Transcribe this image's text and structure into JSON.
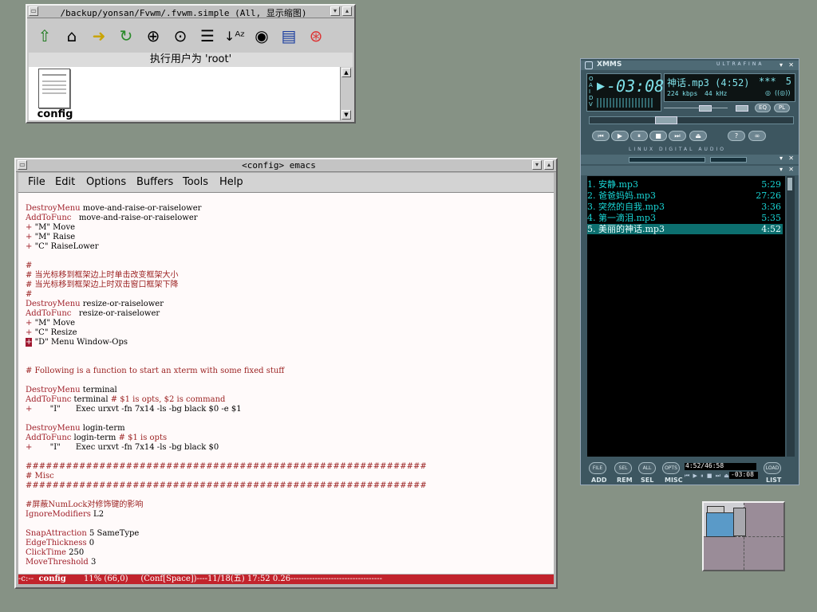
{
  "file_manager": {
    "title": "/backup/yonsan/Fvwm/.fvwm.simple (All, 显示缩图)",
    "status": "执行用户为 'root'",
    "files": [
      {
        "name": "config"
      }
    ],
    "toolbar": [
      "up-icon",
      "home-icon",
      "goto-icon",
      "refresh-icon",
      "zoom-in-icon",
      "zoom-fit-icon",
      "list-view-icon",
      "sort-icon",
      "eye-icon",
      "details-icon",
      "help-icon"
    ]
  },
  "emacs": {
    "title": "<config> emacs",
    "menu": [
      "File",
      "Edit",
      "Options",
      "Buffers",
      "Tools",
      "Help"
    ],
    "lines": [
      [],
      [
        [
          "kw",
          "DestroyMenu"
        ],
        [
          "pl",
          " move-and-raise-or-raiselower"
        ]
      ],
      [
        [
          "kw",
          "AddToFunc"
        ],
        [
          "pl",
          "   move-and-raise-or-raiselower"
        ]
      ],
      [
        [
          "kw",
          "+"
        ],
        [
          "pl",
          " \"M\" Move"
        ]
      ],
      [
        [
          "kw",
          "+"
        ],
        [
          "pl",
          " \"M\" Raise"
        ]
      ],
      [
        [
          "kw",
          "+"
        ],
        [
          "pl",
          " \"C\" RaiseLower"
        ]
      ],
      [],
      [
        [
          "cm",
          "#"
        ]
      ],
      [
        [
          "cm",
          "# 当光标移到框架边上时单击改变框架大小"
        ]
      ],
      [
        [
          "cm",
          "# 当光标移到框架边上时双击窗口框架下降"
        ]
      ],
      [
        [
          "cm",
          "#"
        ]
      ],
      [
        [
          "kw",
          "DestroyMenu"
        ],
        [
          "pl",
          " resize-or-raiselower"
        ]
      ],
      [
        [
          "kw",
          "AddToFunc"
        ],
        [
          "pl",
          "   resize-or-raiselower"
        ]
      ],
      [
        [
          "kw",
          "+"
        ],
        [
          "pl",
          " \"M\" Move"
        ]
      ],
      [
        [
          "kw",
          "+"
        ],
        [
          "pl",
          " \"C\" Resize"
        ]
      ],
      [
        [
          "cursor",
          "+"
        ],
        [
          "pl",
          " \"D\" Menu Window-Ops"
        ]
      ],
      [],
      [],
      [
        [
          "cm",
          "# Following is a function to start an xterm with some fixed stuff"
        ]
      ],
      [],
      [
        [
          "kw",
          "DestroyMenu"
        ],
        [
          "pl",
          " terminal"
        ]
      ],
      [
        [
          "kw",
          "AddToFunc"
        ],
        [
          "pl",
          " terminal "
        ],
        [
          "cm",
          "# $1 is opts, $2 is command"
        ]
      ],
      [
        [
          "kw",
          "+"
        ],
        [
          "pl",
          "       \"I\"      Exec urxvt -fn 7x14 -ls -bg black $0 -e $1"
        ]
      ],
      [],
      [
        [
          "kw",
          "DestroyMenu"
        ],
        [
          "pl",
          " login-term"
        ]
      ],
      [
        [
          "kw",
          "AddToFunc"
        ],
        [
          "pl",
          " login-term "
        ],
        [
          "cm",
          "# $1 is opts"
        ]
      ],
      [
        [
          "kw",
          "+"
        ],
        [
          "pl",
          "       \"I\"      Exec urxvt -fn 7x14 -ls -bg black $0"
        ]
      ],
      [],
      [
        [
          "cm",
          "############################################################"
        ]
      ],
      [
        [
          "cm",
          "# Misc"
        ]
      ],
      [
        [
          "cm",
          "############################################################"
        ]
      ],
      [],
      [
        [
          "cm",
          "#屏蔽NumLock对修饰键的影响"
        ]
      ],
      [
        [
          "kw",
          "IgnoreModifiers"
        ],
        [
          "pl",
          " L2"
        ]
      ],
      [],
      [
        [
          "kw",
          "SnapAttraction"
        ],
        [
          "pl",
          " 5 SameType"
        ]
      ],
      [
        [
          "kw",
          "EdgeThickness"
        ],
        [
          "pl",
          " 0"
        ]
      ],
      [
        [
          "kw",
          "ClickTime"
        ],
        [
          "pl",
          " 250"
        ]
      ],
      [
        [
          "kw",
          "MoveThreshold"
        ],
        [
          "pl",
          " 3"
        ]
      ]
    ],
    "modeline": {
      "prefix": "-c:--  ",
      "buffer": "config",
      "rest": "       11% (66,0)     (Conf[Space])----11/18(五) 17:52 0.26----------------------------------"
    }
  },
  "xmms": {
    "title": "XMMS",
    "brand": "ULTRAFINA",
    "time": "-03:08",
    "track_title": "神话.mp3 (4:52)",
    "rating": "***",
    "track_no": "5",
    "kbps": "224",
    "kbps_label": "kbps",
    "khz": "44",
    "khz_label": "kHz",
    "buttons_small": [
      "EQ",
      "PL"
    ],
    "linux_label": "LINUX DIGITAL AUDIO",
    "status_letters": [
      "O",
      "A",
      "I",
      "D",
      "V"
    ],
    "playlist": [
      {
        "num": "1.",
        "name": "安静.mp3",
        "time": "5:29",
        "selected": false
      },
      {
        "num": "2.",
        "name": "爸爸妈妈.mp3",
        "time": "27:26",
        "selected": false
      },
      {
        "num": "3.",
        "name": "突然的自我.mp3",
        "time": "3:36",
        "selected": false
      },
      {
        "num": "4.",
        "name": "第一滴泪.mp3",
        "time": "5:35",
        "selected": false
      },
      {
        "num": "5.",
        "name": "美丽的神话.mp3",
        "time": "4:52",
        "selected": true
      }
    ],
    "pl_time": "4:52/46:58",
    "pl_remaining": "-03:08",
    "pl_buttons": [
      {
        "icon": "FILE",
        "label": "ADD"
      },
      {
        "icon": "SEL",
        "label": "REM"
      },
      {
        "icon": "ALL",
        "label": "SEL"
      },
      {
        "icon": "OPTS",
        "label": "MISC"
      },
      {
        "icon": "LOAD",
        "label": "LIST"
      }
    ]
  },
  "colors": {
    "desktop": "#869285",
    "modeline": "#c2232c",
    "keyword": "#a0202a",
    "playlist_text": "#19d6d6",
    "playlist_selected": "#0c6f6f"
  }
}
